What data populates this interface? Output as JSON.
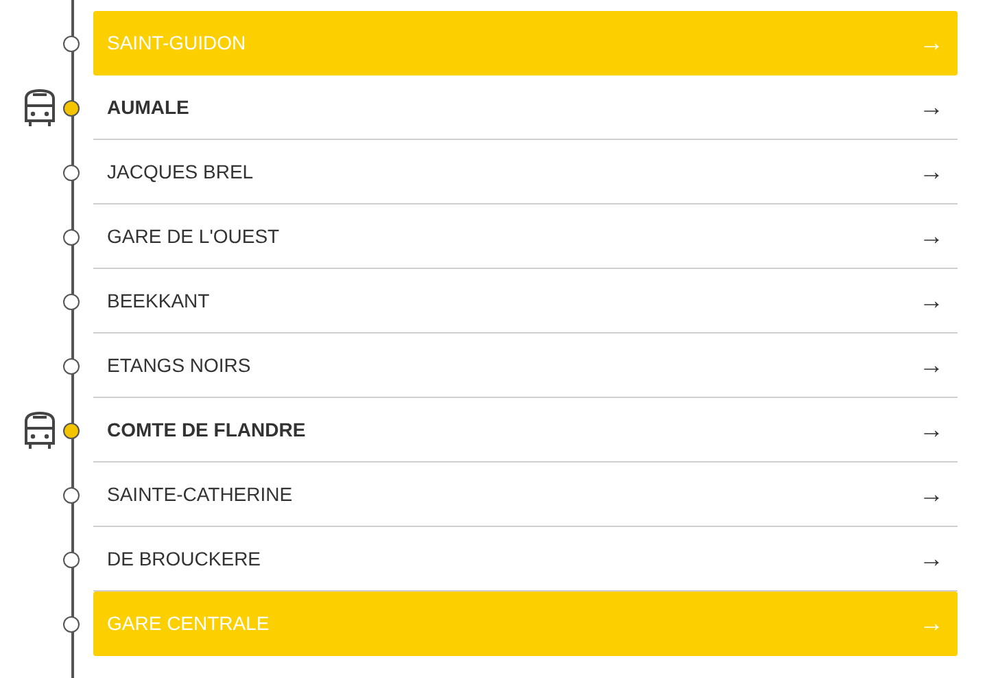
{
  "stops": [
    {
      "name": "SAINT-GUIDON",
      "arrow": "→",
      "highlighted": true,
      "vehicle": false
    },
    {
      "name": "AUMALE",
      "arrow": "→",
      "highlighted": false,
      "vehicle": true
    },
    {
      "name": "JACQUES BREL",
      "arrow": "→",
      "highlighted": false,
      "vehicle": false
    },
    {
      "name": "GARE DE L'OUEST",
      "arrow": "→",
      "highlighted": false,
      "vehicle": false
    },
    {
      "name": "BEEKKANT",
      "arrow": "→",
      "highlighted": false,
      "vehicle": false
    },
    {
      "name": "ETANGS NOIRS",
      "arrow": "→",
      "highlighted": false,
      "vehicle": false
    },
    {
      "name": "COMTE DE FLANDRE",
      "arrow": "→",
      "highlighted": false,
      "vehicle": true
    },
    {
      "name": "SAINTE-CATHERINE",
      "arrow": "→",
      "highlighted": false,
      "vehicle": false
    },
    {
      "name": "DE BROUCKERE",
      "arrow": "→",
      "highlighted": false,
      "vehicle": false
    },
    {
      "name": "GARE CENTRALE",
      "arrow": "→",
      "highlighted": true,
      "vehicle": false
    }
  ]
}
